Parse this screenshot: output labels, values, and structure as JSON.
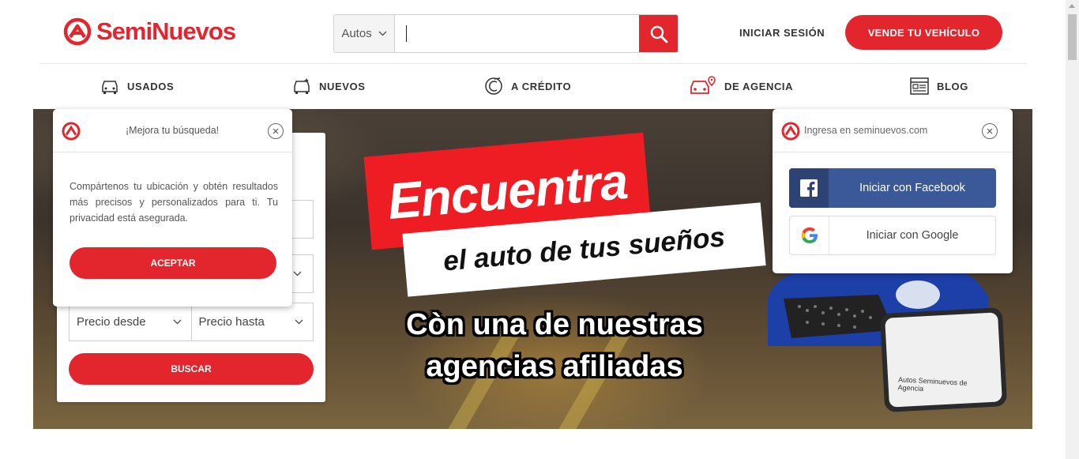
{
  "brand": {
    "name": "SemiNuevos",
    "color": "#e3262e"
  },
  "search": {
    "category": "Autos",
    "placeholder": ""
  },
  "header": {
    "login_label": "INICIAR SESIÓN",
    "sell_label": "VENDE TU VEHÍCULO"
  },
  "nav": [
    {
      "label": "USADOS",
      "icon": "used-car-icon"
    },
    {
      "label": "NUEVOS",
      "icon": "new-car-icon"
    },
    {
      "label": "A CRÉDITO",
      "icon": "credit-icon"
    },
    {
      "label": "DE AGENCIA",
      "icon": "agency-car-icon"
    },
    {
      "label": "BLOG",
      "icon": "blog-icon"
    }
  ],
  "hero": {
    "headline": "Encuentra",
    "subheadline": "el auto de tus sueños",
    "line1": "Còn una de nuestras",
    "line2": "agencias afiliadas",
    "phone_text": "Autos Seminuevos de Agencia"
  },
  "filter": {
    "price_from": "Precio desde",
    "price_to": "Precio hasta",
    "search_button": "BUSCAR"
  },
  "location_popup": {
    "title": "¡Mejora tu búsqueda!",
    "body": "Compártenos tu ubicación y obtén resultados más precisos y personalizados para ti. Tu privacidad está asegurada.",
    "accept_label": "ACEPTAR"
  },
  "login_popup": {
    "title": "Ingresa en seminuevos.com",
    "facebook_label": "Iniciar con Facebook",
    "google_label": "Iniciar con Google"
  }
}
